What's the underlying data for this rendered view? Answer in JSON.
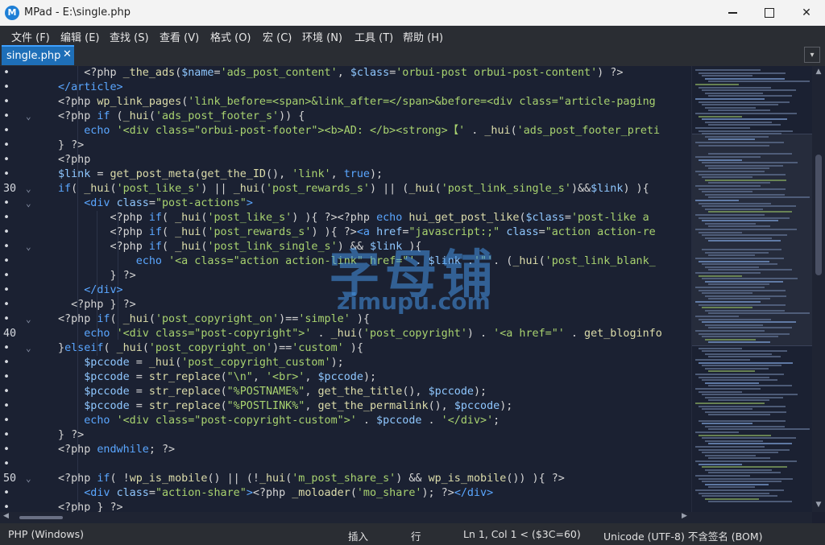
{
  "window": {
    "title": "MPad - E:\\single.php",
    "icon_letter": "M",
    "minimize": "—",
    "close": "✕"
  },
  "menu": [
    "文件 (F)",
    "编辑 (E)",
    "查找 (S)",
    "查看 (V)",
    "格式 (O)",
    "宏 (C)",
    "环境 (N)",
    "工具 (T)",
    "帮助 (H)"
  ],
  "tabs": [
    {
      "label": "single.php",
      "close": "✕"
    }
  ],
  "tab_dropdown": "▾",
  "editor": {
    "lines": [
      {
        "num": "•",
        "fold": "",
        "html": "    &lt;?php <span class=\"f\">_the_ads</span>(<span class=\"v\">$name</span>=<span class=\"s\">'ads_post_content'</span>, <span class=\"v\">$class</span>=<span class=\"s\">'orbui-post orbui-post-content'</span>) ?&gt;"
      },
      {
        "num": "•",
        "fold": "",
        "html": "<span class=\"k\">&lt;/article&gt;</span>"
      },
      {
        "num": "•",
        "fold": "",
        "html": "&lt;?php <span class=\"f\">wp_link_pages</span>(<span class=\"s\">'link_before=&lt;span&gt;&amp;link_after=&lt;/span&gt;&amp;before=&lt;div class=\"article-paging</span>"
      },
      {
        "num": "•",
        "fold": "⌄",
        "html": "&lt;?php <span class=\"k\">if</span> (<span class=\"f\">_hui</span>(<span class=\"s\">'ads_post_footer_s'</span>)) {"
      },
      {
        "num": "•",
        "fold": "",
        "html": "    <span class=\"k\">echo</span> <span class=\"s\">'&lt;div class=\"orbui-post-footer\"&gt;&lt;b&gt;AD: &lt;/b&gt;&lt;strong&gt;【'</span> . <span class=\"f\">_hui</span>(<span class=\"s\">'ads_post_footer_preti</span>"
      },
      {
        "num": "•",
        "fold": "",
        "html": "} ?&gt;"
      },
      {
        "num": "•",
        "fold": "",
        "html": "&lt;?php"
      },
      {
        "num": "•",
        "fold": "",
        "html": "<span class=\"v\">$link</span> = <span class=\"f\">get_post_meta</span>(<span class=\"f\">get_the_ID</span>(), <span class=\"s\">'link'</span>, <span class=\"k\">true</span>);"
      },
      {
        "num": "30",
        "fold": "⌄",
        "html": "<span class=\"k\">if</span>( <span class=\"f\">_hui</span>(<span class=\"s\">'post_like_s'</span>) || <span class=\"f\">_hui</span>(<span class=\"s\">'post_rewards_s'</span>) || (<span class=\"f\">_hui</span>(<span class=\"s\">'post_link_single_s'</span>)&amp;&amp;<span class=\"v\">$link</span>) ){"
      },
      {
        "num": "•",
        "fold": "⌄",
        "html": "    <span class=\"k\">&lt;div</span> <span class=\"v\">class</span>=<span class=\"s\">\"post-actions\"</span><span class=\"k\">&gt;</span>"
      },
      {
        "num": "•",
        "fold": "",
        "html": "        &lt;?php <span class=\"k\">if</span>( <span class=\"f\">_hui</span>(<span class=\"s\">'post_like_s'</span>) ){ ?&gt;&lt;?php <span class=\"k\">echo</span> <span class=\"f\">hui_get_post_like</span>(<span class=\"v\">$class</span>=<span class=\"s\">'post-like a</span>"
      },
      {
        "num": "•",
        "fold": "",
        "html": "        &lt;?php <span class=\"k\">if</span>( <span class=\"f\">_hui</span>(<span class=\"s\">'post_rewards_s'</span>) ){ ?&gt;<span class=\"k\">&lt;a</span> <span class=\"v\">href</span>=<span class=\"s\">\"javascript:;\"</span> <span class=\"v\">class</span>=<span class=\"s\">\"action action-re</span>"
      },
      {
        "num": "•",
        "fold": "⌄",
        "html": "        &lt;?php <span class=\"k\">if</span>( <span class=\"f\">_hui</span>(<span class=\"s\">'post_link_single_s'</span>) &amp;&amp; <span class=\"v\">$link</span> ){"
      },
      {
        "num": "•",
        "fold": "",
        "html": "            <span class=\"k\">echo</span> <span class=\"s\">'&lt;a class=\"action action-link\" href=\"'</span>. <span class=\"v\">$link</span> .<span class=\"s\">'\"'</span>. (<span class=\"f\">_hui</span>(<span class=\"s\">'post_link_blank_</span>"
      },
      {
        "num": "•",
        "fold": "",
        "html": "        } ?&gt;"
      },
      {
        "num": "•",
        "fold": "",
        "html": "    <span class=\"k\">&lt;/div&gt;</span>"
      },
      {
        "num": "•",
        "fold": "",
        "html": "  &lt;?php } ?&gt;"
      },
      {
        "num": "•",
        "fold": "⌄",
        "html": "&lt;?php <span class=\"k\">if</span>( <span class=\"f\">_hui</span>(<span class=\"s\">'post_copyright_on'</span>)==<span class=\"s\">'simple'</span> ){"
      },
      {
        "num": "40",
        "fold": "",
        "html": "    <span class=\"k\">echo</span> <span class=\"s\">'&lt;div class=\"post-copyright\"&gt;'</span> . <span class=\"f\">_hui</span>(<span class=\"s\">'post_copyright'</span>) . <span class=\"s\">'&lt;a href=\"'</span> . <span class=\"f\">get_bloginfo</span>"
      },
      {
        "num": "•",
        "fold": "⌄",
        "html": "}<span class=\"k\">elseif</span>( <span class=\"f\">_hui</span>(<span class=\"s\">'post_copyright_on'</span>)==<span class=\"s\">'custom'</span> ){"
      },
      {
        "num": "•",
        "fold": "",
        "html": "    <span class=\"v\">$pccode</span> = <span class=\"f\">_hui</span>(<span class=\"s\">'post_copyright_custom'</span>);"
      },
      {
        "num": "•",
        "fold": "",
        "html": "    <span class=\"v\">$pccode</span> = <span class=\"f\">str_replace</span>(<span class=\"s\">\"\\n\"</span>, <span class=\"s\">'&lt;br&gt;'</span>, <span class=\"v\">$pccode</span>);"
      },
      {
        "num": "•",
        "fold": "",
        "html": "    <span class=\"v\">$pccode</span> = <span class=\"f\">str_replace</span>(<span class=\"s\">\"%POSTNAME%\"</span>, <span class=\"f\">get_the_title</span>(), <span class=\"v\">$pccode</span>);"
      },
      {
        "num": "•",
        "fold": "",
        "html": "    <span class=\"v\">$pccode</span> = <span class=\"f\">str_replace</span>(<span class=\"s\">\"%POSTLINK%\"</span>, <span class=\"f\">get_the_permalink</span>(), <span class=\"v\">$pccode</span>);"
      },
      {
        "num": "•",
        "fold": "",
        "html": "    <span class=\"k\">echo</span> <span class=\"s\">'&lt;div class=\"post-copyright-custom\"&gt;'</span> . <span class=\"v\">$pccode</span> . <span class=\"s\">'&lt;/div&gt;'</span>;"
      },
      {
        "num": "•",
        "fold": "",
        "html": "} ?&gt;"
      },
      {
        "num": "•",
        "fold": "",
        "html": "&lt;?php <span class=\"k\">endwhile</span>; ?&gt;"
      },
      {
        "num": "•",
        "fold": "",
        "html": ""
      },
      {
        "num": "50",
        "fold": "⌄",
        "html": "&lt;?php <span class=\"k\">if</span>( !<span class=\"f\">wp_is_mobile</span>() || (!<span class=\"f\">_hui</span>(<span class=\"s\">'m_post_share_s'</span>) &amp;&amp; <span class=\"f\">wp_is_mobile</span>()) ){ ?&gt;"
      },
      {
        "num": "•",
        "fold": "",
        "html": "    <span class=\"k\">&lt;div</span> <span class=\"v\">class</span>=<span class=\"s\">\"action-share\"</span><span class=\"k\">&gt;</span>&lt;?php <span class=\"f\">_moloader</span>(<span class=\"s\">'mo_share'</span>); ?&gt;<span class=\"k\">&lt;/div&gt;</span>"
      },
      {
        "num": "•",
        "fold": "",
        "html": "&lt;?php } ?&gt;"
      }
    ]
  },
  "watermark": {
    "big": "字母铺",
    "small": "zimupu.com"
  },
  "scroll": {
    "up": "▲",
    "down": "▼",
    "left": "◀",
    "right": "▶"
  },
  "status": {
    "language": "PHP (Windows)",
    "mode": "插入",
    "line_mode": "行",
    "position": "Ln 1, Col 1 < ($3C=60)",
    "encoding": "Unicode (UTF-8) 不含签名 (BOM)"
  },
  "colors": {
    "editor_bg": "#1b2132",
    "keyword": "#5aa6ff",
    "function": "#dcdcaa",
    "string": "#a8d26f",
    "variable": "#8fc7ff",
    "tab_active": "#1e6fb8"
  }
}
